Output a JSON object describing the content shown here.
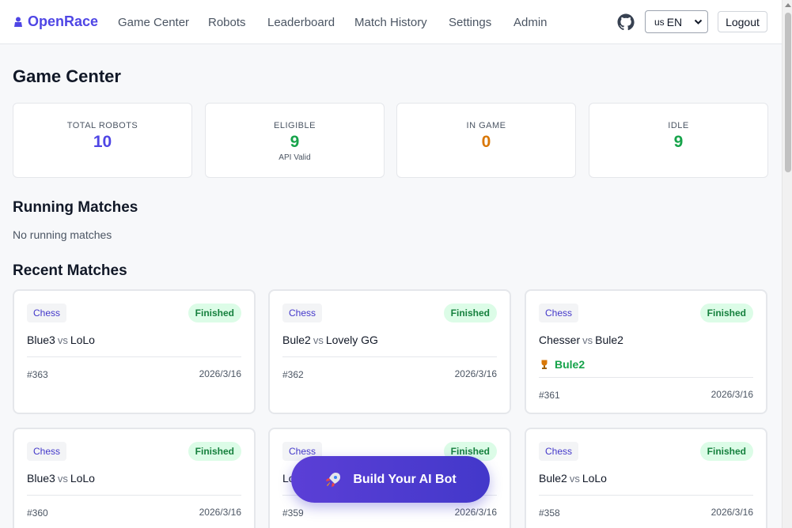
{
  "brand": {
    "name": "OpenRace"
  },
  "nav": {
    "links": [
      "Game Center",
      "Robots",
      "Leaderboard",
      "Match History",
      "Settings",
      "Admin"
    ],
    "language": {
      "flag": "us",
      "label": "EN"
    },
    "logout_label": "Logout"
  },
  "page": {
    "title": "Game Center"
  },
  "stats": [
    {
      "label": "TOTAL ROBOTS",
      "value": "10",
      "sub": "",
      "color": "#4f46e5"
    },
    {
      "label": "ELIGIBLE",
      "value": "9",
      "sub": "API Valid",
      "color": "#16a34a"
    },
    {
      "label": "IN GAME",
      "value": "0",
      "sub": "",
      "color": "#d97706"
    },
    {
      "label": "IDLE",
      "value": "9",
      "sub": "",
      "color": "#16a34a"
    }
  ],
  "running": {
    "title": "Running Matches",
    "empty": "No running matches"
  },
  "recent": {
    "title": "Recent Matches",
    "vs_label": "vs",
    "matches": [
      {
        "game": "Chess",
        "status": "Finished",
        "p1": "Blue3",
        "p2": "LoLo",
        "winner": "",
        "id": "#363",
        "date": "2026/3/16"
      },
      {
        "game": "Chess",
        "status": "Finished",
        "p1": "Bule2",
        "p2": "Lovely GG",
        "winner": "",
        "id": "#362",
        "date": "2026/3/16"
      },
      {
        "game": "Chess",
        "status": "Finished",
        "p1": "Chesser",
        "p2": "Bule2",
        "winner": "Bule2",
        "id": "#361",
        "date": "2026/3/16"
      },
      {
        "game": "Chess",
        "status": "Finished",
        "p1": "Blue3",
        "p2": "LoLo",
        "winner": "",
        "id": "#360",
        "date": "2026/3/16"
      },
      {
        "game": "Chess",
        "status": "Finished",
        "p1": "Lo",
        "p2": "",
        "winner": "",
        "id": "#359",
        "date": "2026/3/16"
      },
      {
        "game": "Chess",
        "status": "Finished",
        "p1": "Bule2",
        "p2": "LoLo",
        "winner": "",
        "id": "#358",
        "date": "2026/3/16"
      }
    ]
  },
  "cta": {
    "label": "Build Your AI Bot",
    "icon": "rocket-icon"
  },
  "colors": {
    "accent": "#4f46e5",
    "success": "#16a34a",
    "warning": "#d97706"
  }
}
